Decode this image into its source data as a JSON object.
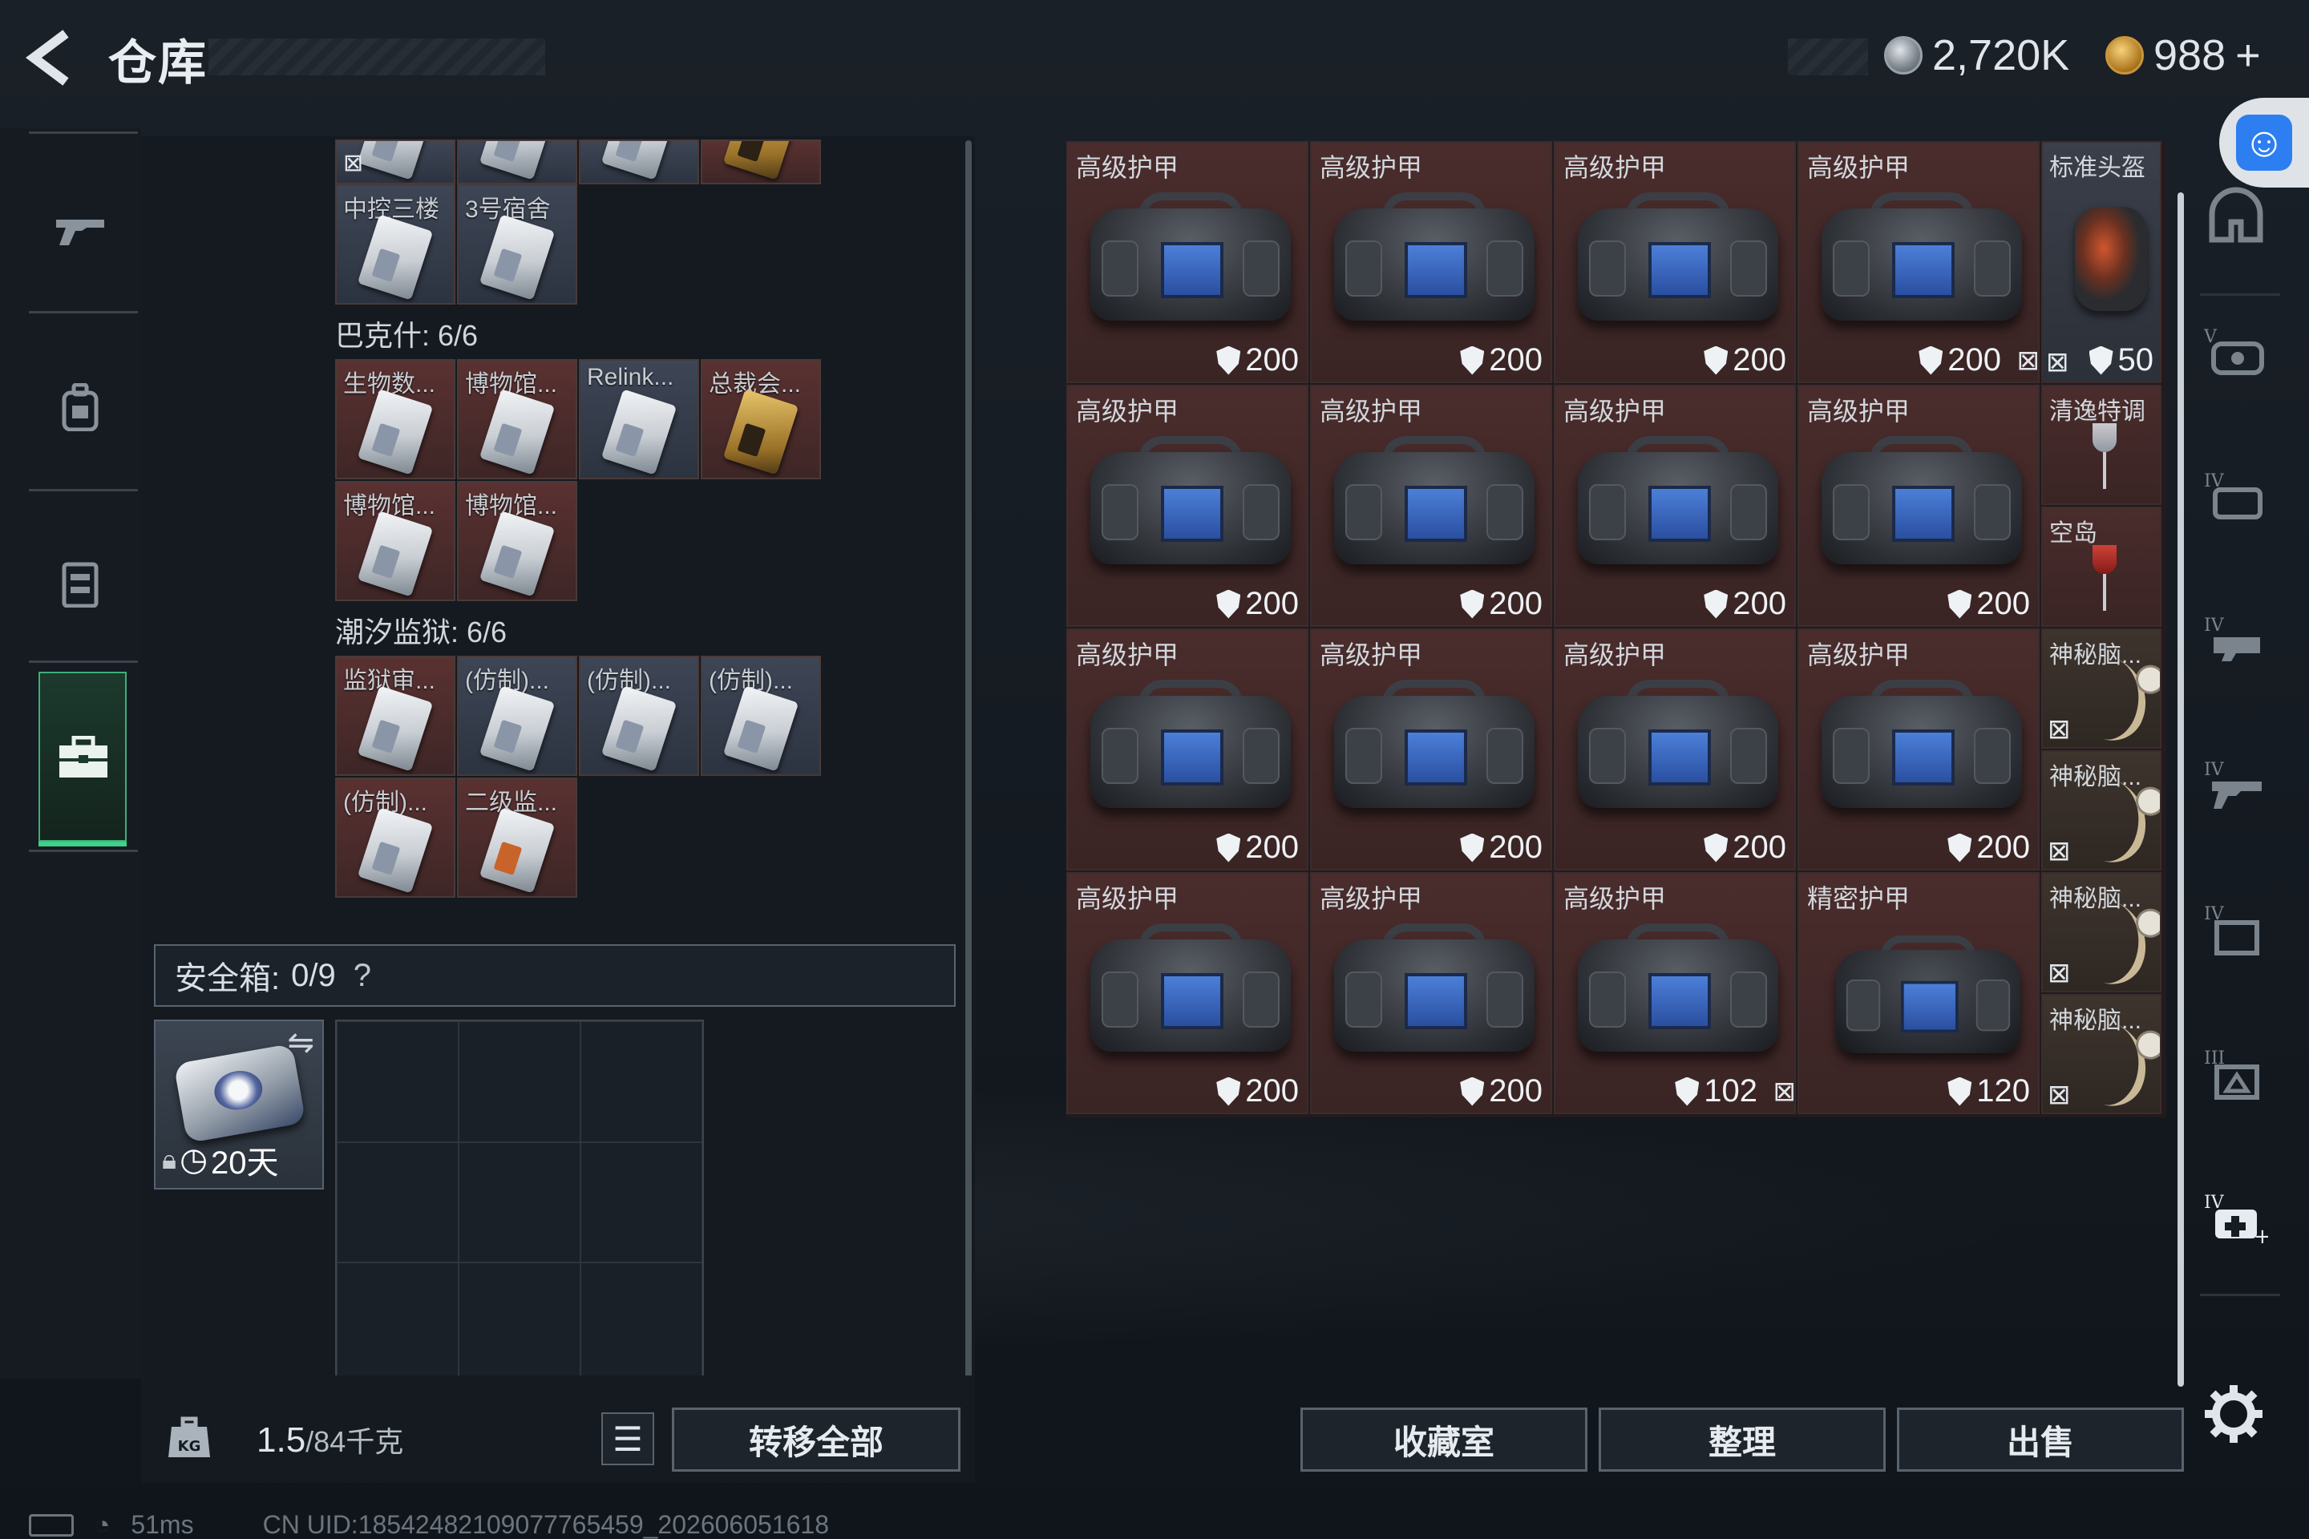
{
  "header": {
    "title": "仓库",
    "currency1": "2,720K",
    "currency2": "988",
    "currency2_plus": "+"
  },
  "left_nav": {
    "items": [
      {
        "icon": "gun-icon"
      },
      {
        "icon": "backpack-icon"
      },
      {
        "icon": "vest-icon"
      },
      {
        "icon": "case-icon",
        "selected": true
      }
    ]
  },
  "storage": {
    "top_partial_note": "",
    "row0": [
      {
        "name": "中控三楼",
        "type": "blue"
      },
      {
        "name": "3号宿舍",
        "type": "blue"
      }
    ],
    "section1": "巴克什: 6/6",
    "row1": [
      {
        "name": "生物数...",
        "type": "red"
      },
      {
        "name": "博物馆...",
        "type": "red"
      },
      {
        "name": "Relink...",
        "type": "blue"
      },
      {
        "name": "总裁会...",
        "type": "red",
        "gold": true
      }
    ],
    "row2": [
      {
        "name": "博物馆...",
        "type": "red"
      },
      {
        "name": "博物馆...",
        "type": "red"
      }
    ],
    "section2": "潮汐监狱: 6/6",
    "row3": [
      {
        "name": "监狱审...",
        "type": "red"
      },
      {
        "name": "(仿制)...",
        "type": "blue"
      },
      {
        "name": "(仿制)...",
        "type": "blue"
      },
      {
        "name": "(仿制)...",
        "type": "blue"
      }
    ],
    "row4": [
      {
        "name": "(仿制)...",
        "type": "red"
      },
      {
        "name": "二级监...",
        "type": "red"
      }
    ]
  },
  "safe_box": {
    "label": "安全箱:",
    "count": "0/9",
    "help": "?",
    "days": "20天"
  },
  "footer_left": {
    "weight": "1.5",
    "capacity": "/84千克",
    "transfer_all": "转移全部"
  },
  "grid": {
    "rows": [
      [
        {
          "name": "高级护甲",
          "val": "200"
        },
        {
          "name": "高级护甲",
          "val": "200"
        },
        {
          "name": "高级护甲",
          "val": "200"
        },
        {
          "name": "高级护甲",
          "val": "200"
        }
      ],
      [
        {
          "name": "高级护甲",
          "val": "200"
        },
        {
          "name": "高级护甲",
          "val": "200"
        },
        {
          "name": "高级护甲",
          "val": "200"
        },
        {
          "name": "高级护甲",
          "val": "200"
        }
      ],
      [
        {
          "name": "高级护甲",
          "val": "200"
        },
        {
          "name": "高级护甲",
          "val": "200"
        },
        {
          "name": "高级护甲",
          "val": "200"
        },
        {
          "name": "高级护甲",
          "val": "200"
        }
      ],
      [
        {
          "name": "高级护甲",
          "val": "200"
        },
        {
          "name": "高级护甲",
          "val": "200"
        },
        {
          "name": "高级护甲",
          "val": "102"
        },
        {
          "name": "精密护甲",
          "val": "120"
        }
      ]
    ],
    "side": {
      "helmet_name": "标准头盔",
      "helmet_val": "50",
      "drink1": "清逸特调",
      "drink2": "空岛",
      "mystery": "神秘脑..."
    }
  },
  "buttons": {
    "collection": "收藏室",
    "organize": "整理",
    "sell": "出售"
  },
  "status": {
    "ping": "51ms",
    "uid": "CN UID:18542482109077765459_202606051618"
  },
  "colors": {
    "accent_green": "#3fd08a",
    "item_red": "#4a2c2c",
    "item_blue": "#3e4656",
    "accessibility_blue": "#2d7ef0"
  }
}
